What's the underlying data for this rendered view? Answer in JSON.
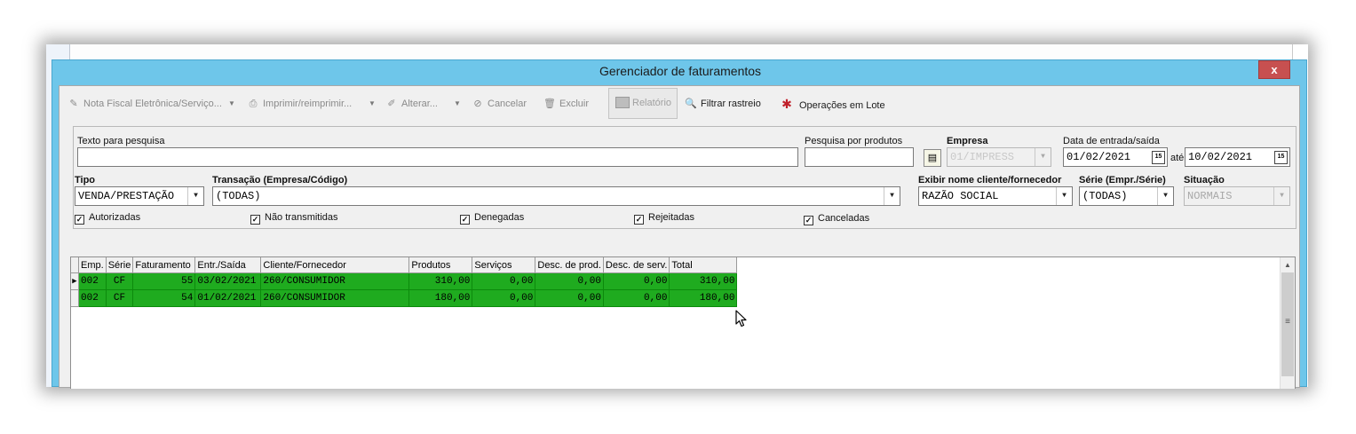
{
  "window": {
    "title": "Gerenciador de faturamentos",
    "close_glyph": "x"
  },
  "toolbar": {
    "nfe_label": "Nota Fiscal Eletrônica/Serviço...",
    "print_label": "Imprimir/reimprimir...",
    "alter_label": "Alterar...",
    "cancel_label": "Cancelar",
    "delete_label": "Excluir",
    "report_label": "Relatório",
    "filter_label": "Filtrar rastreio",
    "batch_label": "Operações em Lote"
  },
  "filters": {
    "search_label": "Texto para pesquisa",
    "search_value": "",
    "product_search_label": "Pesquisa por produtos",
    "product_search_value": "",
    "company_label": "Empresa",
    "company_value": "01/IMPRESS",
    "date_label": "Data de entrada/saída",
    "date_from": "01/02/2021",
    "date_sep": "até",
    "date_to": "10/02/2021",
    "type_label": "Tipo",
    "type_value": "VENDA/PRESTAÇÃO",
    "transaction_label": "Transação (Empresa/Código)",
    "transaction_value": "(TODAS)",
    "client_name_label": "Exibir nome cliente/fornecedor",
    "client_name_value": "RAZÃO SOCIAL",
    "series_label": "Série (Empr./Série)",
    "series_value": "(TODAS)",
    "situation_label": "Situação",
    "situation_value": "NORMAIS",
    "checkboxes": [
      {
        "label": "Autorizadas",
        "checked": true
      },
      {
        "label": "Não transmitidas",
        "checked": true
      },
      {
        "label": "Denegadas",
        "checked": true
      },
      {
        "label": "Rejeitadas",
        "checked": true
      },
      {
        "label": "Canceladas",
        "checked": true
      }
    ]
  },
  "grid": {
    "columns": [
      "Emp.",
      "Série",
      "Faturamento",
      "Entr./Saída",
      "Cliente/Fornecedor",
      "Produtos",
      "Serviços",
      "Desc. de prod.",
      "Desc. de serv.",
      "Total"
    ],
    "rows": [
      {
        "emp": "002",
        "serie": "CF",
        "faturamento": "55",
        "data": "03/02/2021",
        "cliente": "260/CONSUMIDOR",
        "produtos": "310,00",
        "servicos": "0,00",
        "desc_prod": "0,00",
        "desc_serv": "0,00",
        "total": "310,00"
      },
      {
        "emp": "002",
        "serie": "CF",
        "faturamento": "54",
        "data": "01/02/2021",
        "cliente": "260/CONSUMIDOR",
        "produtos": "180,00",
        "servicos": "0,00",
        "desc_prod": "0,00",
        "desc_serv": "0,00",
        "total": "180,00"
      }
    ]
  },
  "colors": {
    "title_bar": "#6ec6ea",
    "row_highlight": "#1fab1f",
    "close_button": "#c75050"
  }
}
